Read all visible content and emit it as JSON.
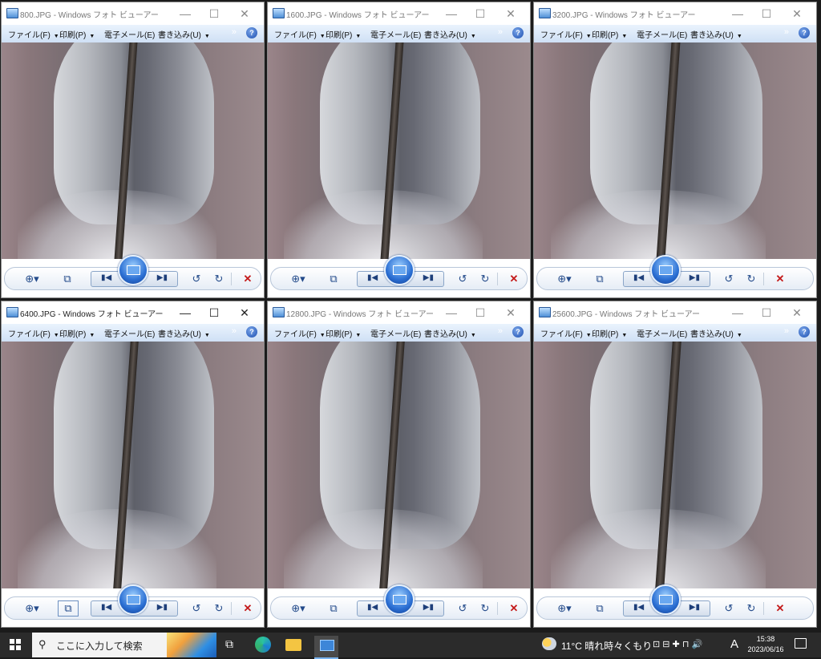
{
  "common": {
    "menus": [
      {
        "label": "ファイル(F)"
      },
      {
        "label": "印刷(P)"
      },
      {
        "label": "電子メール(E)"
      },
      {
        "label": "書き込み(U)"
      }
    ],
    "minimize": "—",
    "maximize": "☐",
    "close": "✕",
    "help": "?",
    "chevron": "»"
  },
  "windows": [
    {
      "title": "800.JPG - Windows フォト ビューアー",
      "active": false
    },
    {
      "title": "1600.JPG - Windows フォト ビューアー",
      "active": false
    },
    {
      "title": "3200.JPG - Windows フォト ビューアー",
      "active": false
    },
    {
      "title": "6400.JPG - Windows フォト ビューアー",
      "active": true
    },
    {
      "title": "12800.JPG - Windows フォト ビューアー",
      "active": false
    },
    {
      "title": "25600.JPG - Windows フォト ビューアー",
      "active": false
    }
  ],
  "taskbar": {
    "search_placeholder": "ここに入力して検索",
    "weather": "11°C  晴れ時々くもり",
    "ime": "A",
    "time": "15:38",
    "date": "2023/06/16"
  },
  "icons": {
    "search": "⚲",
    "zoom": "⊕▾",
    "fit": "⧉",
    "prev": "▮◀",
    "next": "▶▮",
    "rotate_ccw": "↺",
    "rotate_cw": "↻",
    "delete": "✕",
    "task_view": "⧉",
    "tray": "⊡ ⊟ ✚ ⊓ 🔊"
  }
}
